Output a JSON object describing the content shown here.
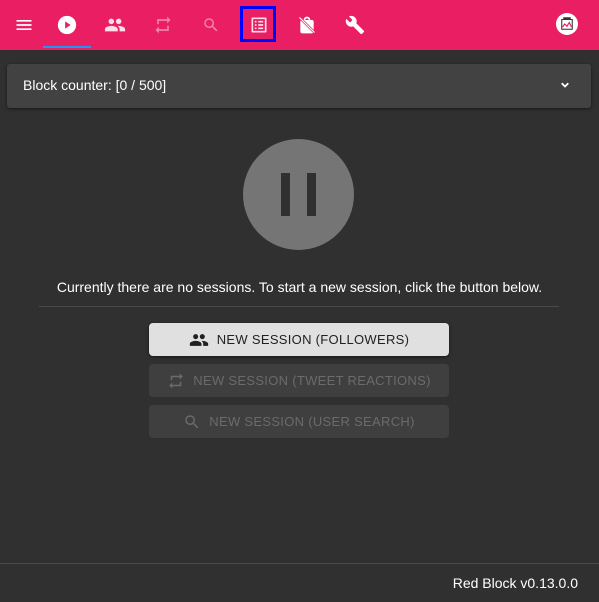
{
  "colors": {
    "topbar": "#e91e63",
    "active_indicator": "#2196f3",
    "highlight_box": "#0000ff",
    "background": "#303030",
    "panel": "#424242"
  },
  "topbar": {
    "tabs": [
      {
        "icon": "menu-icon",
        "active": false,
        "enabled": true
      },
      {
        "icon": "play-circle-icon",
        "active": true,
        "enabled": true
      },
      {
        "icon": "people-icon",
        "active": false,
        "enabled": true
      },
      {
        "icon": "repeat-icon",
        "active": false,
        "enabled": false
      },
      {
        "icon": "search-icon",
        "active": false,
        "enabled": false
      },
      {
        "icon": "list-alt-icon",
        "active": false,
        "enabled": true,
        "highlighted": true
      },
      {
        "icon": "no-shopping-bag-icon",
        "active": false,
        "enabled": true
      },
      {
        "icon": "wrench-icon",
        "active": false,
        "enabled": true
      }
    ],
    "avatar_icon": "user-avatar-icon"
  },
  "panel": {
    "title": "Block counter: [0 / 500]",
    "expand_icon": "chevron-down-icon"
  },
  "main": {
    "status_icon": "pause-icon",
    "message": "Currently there are no sessions. To start a new session, click the button below.",
    "buttons": [
      {
        "label": "NEW SESSION (FOLLOWERS)",
        "icon": "people-icon",
        "enabled": true
      },
      {
        "label": "NEW SESSION (TWEET REACTIONS)",
        "icon": "repeat-icon",
        "enabled": false
      },
      {
        "label": "NEW SESSION (USER SEARCH)",
        "icon": "search-icon",
        "enabled": false
      }
    ]
  },
  "footer": {
    "version": "Red Block v0.13.0.0"
  }
}
